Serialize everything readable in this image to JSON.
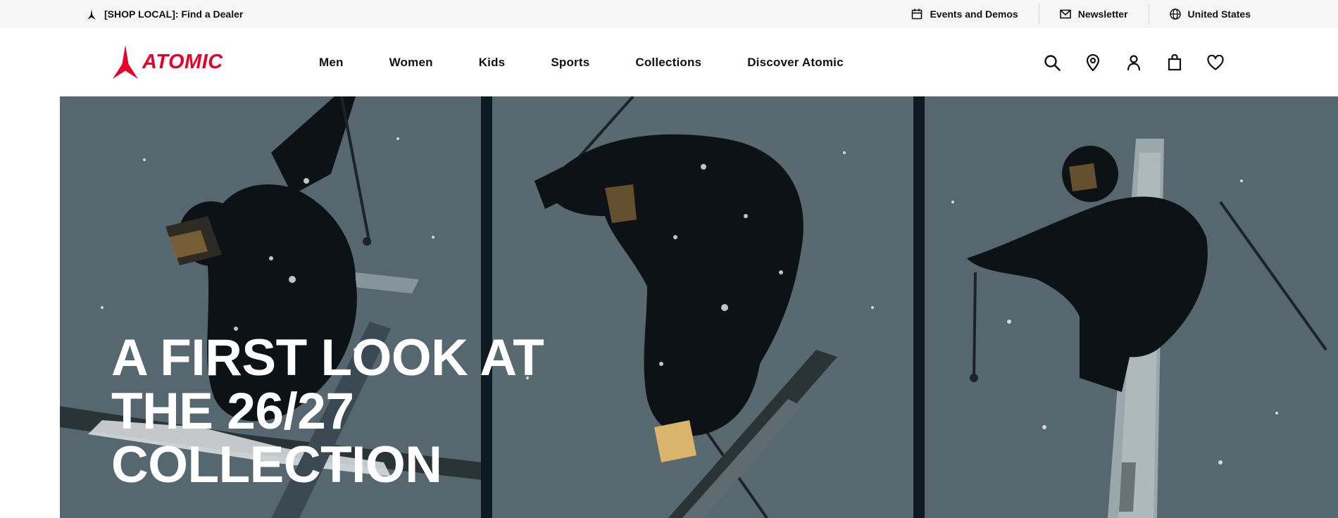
{
  "topbar": {
    "dealer_text": "[SHOP LOCAL]: Find a Dealer",
    "events_text": "Events and Demos",
    "newsletter_text": "Newsletter",
    "region_text": "United States"
  },
  "brand": {
    "name": "ATOMIC",
    "color": "#e4002b"
  },
  "nav": {
    "items": [
      "Men",
      "Women",
      "Kids",
      "Sports",
      "Collections",
      "Discover Atomic"
    ]
  },
  "header_icons": [
    "search-icon",
    "location-pin-icon",
    "account-icon",
    "shopping-bag-icon",
    "wishlist-heart-icon"
  ],
  "hero": {
    "title_line1": "A FIRST LOOK AT",
    "title_line2": "THE 26/27",
    "title_line3": "COLLECTION",
    "images": [
      "skier-panel-left",
      "skier-panel-center",
      "skier-panel-right"
    ],
    "background": "#5a6b73"
  }
}
